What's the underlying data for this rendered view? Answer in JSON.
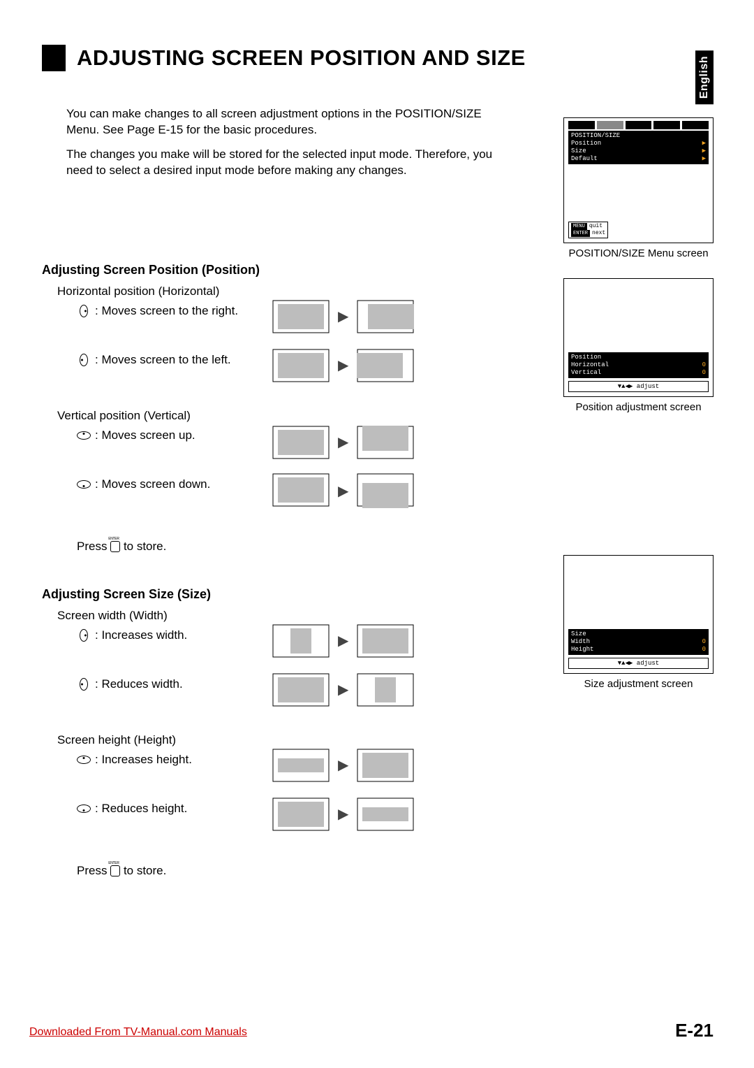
{
  "title": "ADJUSTING SCREEN POSITION AND SIZE",
  "language_tab": "English",
  "intro": {
    "p1": "You can make changes to all screen adjustment options in the POSITION/SIZE Menu. See Page E-15 for the basic procedures.",
    "p2": "The changes you make will be stored for the selected input mode. Therefore, you need to select a desired input mode before making any changes."
  },
  "menu_screen": {
    "heading": "POSITION/SIZE",
    "items": [
      {
        "label": "Position",
        "value": "▶"
      },
      {
        "label": "Size",
        "value": "▶"
      },
      {
        "label": "Default",
        "value": "▶"
      }
    ],
    "footer": [
      {
        "key": "MENU",
        "label": "quit"
      },
      {
        "key": "ENTER",
        "label": "next"
      }
    ],
    "caption": "POSITION/SIZE Menu screen"
  },
  "position_section": {
    "heading": "Adjusting Screen Position (Position)",
    "horizontal": {
      "label": "Horizontal position (Horizontal)",
      "right": ": Moves screen to the right.",
      "left": ": Moves screen to the left."
    },
    "vertical": {
      "label": "Vertical position (Vertical)",
      "up": ": Moves screen up.",
      "down": ": Moves screen down."
    },
    "store": "to store.",
    "store_prefix": "Press",
    "osd": {
      "heading": "Position",
      "rows": [
        {
          "label": "Horizontal",
          "value": "0"
        },
        {
          "label": "Vertical",
          "value": "0"
        }
      ],
      "hint": "▼▲◀▶ adjust",
      "caption": "Position  adjustment screen"
    }
  },
  "size_section": {
    "heading": "Adjusting Screen Size (Size)",
    "width": {
      "label": "Screen width (Width)",
      "inc": ": Increases width.",
      "dec": ": Reduces width."
    },
    "height": {
      "label": "Screen height (Height)",
      "inc": ": Increases height.",
      "dec": ": Reduces height."
    },
    "store": "to store.",
    "store_prefix": "Press",
    "osd": {
      "heading": "Size",
      "rows": [
        {
          "label": "Width",
          "value": "0"
        },
        {
          "label": "Height",
          "value": "0"
        }
      ],
      "hint": "▼▲◀▶ adjust",
      "caption": "Size  adjustment screen"
    }
  },
  "footer": {
    "download": "Downloaded From TV-Manual.com Manuals",
    "page": "E-21"
  }
}
